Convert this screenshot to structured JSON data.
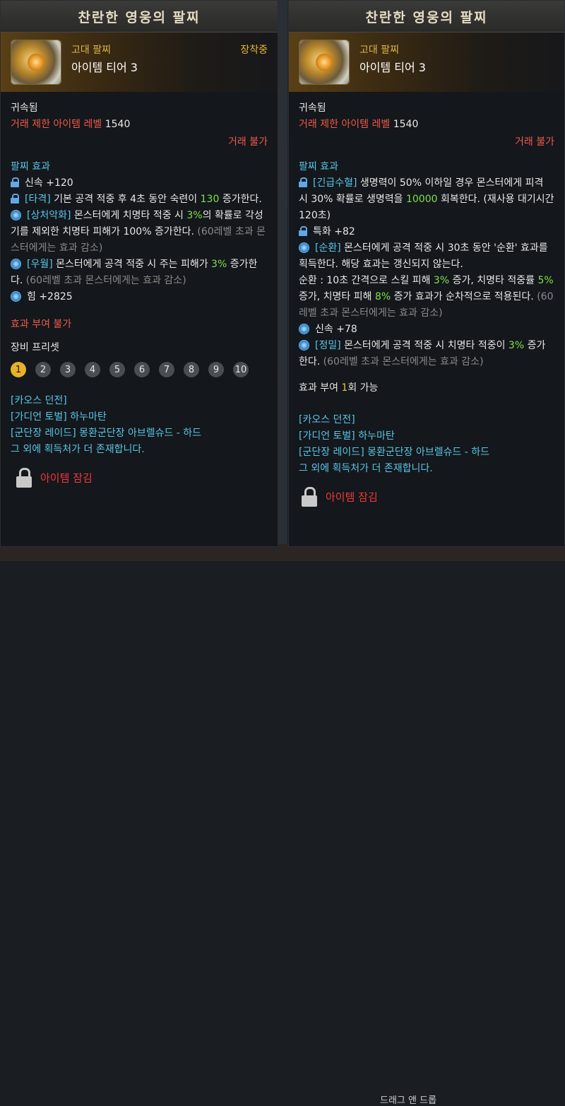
{
  "background": {
    "hint_text": "드래그 앤 드롭"
  },
  "left": {
    "title": "찬란한 영웅의 팔찌",
    "grade": "고대 팔찌",
    "tier": "아이템 티어 3",
    "equipped": "장착중",
    "bound": "귀속됨",
    "trade_level_label": "거래 제한 아이템 레벨",
    "trade_level_value": "1540",
    "trade": "거래 불가",
    "effects_title": "팔찌 효과",
    "effects": [
      {
        "icon": "lock-icon",
        "text": "신속 +120"
      },
      {
        "icon": "lock-icon",
        "pre": "[타격]",
        "text": " 기본 공격 적중 후 4초 동안 숙련이 ",
        "hl": "130",
        "post": " 증가한다."
      },
      {
        "icon": "gem-icon",
        "pre": "[상처악화]",
        "text": " 몬스터에게 치명타 적중 시 ",
        "hl": "3%",
        "post": "의 확률로 각성기를 제외한 치명타 피해가 100% 증가한다.",
        "note": " (60레벨 초과 몬스터에게는 효과 감소)"
      },
      {
        "icon": "gem-icon",
        "pre": "[우월]",
        "text": " 몬스터에게 공격 적중 시 주는 피해가 ",
        "hl": "3%",
        "post": " 증가한다.",
        "note": " (60레벨 초과 몬스터에게는 효과 감소)"
      },
      {
        "icon": "gem-icon",
        "text": "힘 +2825"
      }
    ],
    "grant": "효과 부여 불가",
    "preset_title": "장비 프리셋",
    "presets": [
      "1",
      "2",
      "3",
      "4",
      "5",
      "6",
      "7",
      "8",
      "9",
      "10"
    ],
    "sources": [
      "[카오스 던전]",
      "[가디언 토벌] 하누마탄",
      "[군단장 레이드] 몽환군단장 아브렐슈드 - 하드",
      "그 외에 획득처가 더 존재합니다."
    ],
    "lock_label": "아이템 잠김"
  },
  "right": {
    "title": "찬란한 영웅의 팔찌",
    "grade": "고대 팔찌",
    "tier": "아이템 티어 3",
    "bound": "귀속됨",
    "trade_level_label": "거래 제한 아이템 레벨",
    "trade_level_value": "1540",
    "trade": "거래 불가",
    "effects_title": "팔찌 효과",
    "effects": [
      {
        "icon": "lock-icon",
        "pre": "[긴급수혈]",
        "text": " 생명력이 50% 이하일 경우 몬스터에게 피격 시 30% 확률로 생명력을 ",
        "hl": "10000",
        "post": " 회복한다. (재사용 대기시간 120초)"
      },
      {
        "icon": "lock-icon",
        "text": "특화 +82"
      },
      {
        "icon": "gem-icon",
        "pre": "[순환]",
        "text": " 몬스터에게 공격 적중 시 30초 동안 '순환' 효과를 획득한다. 해당 효과는 갱신되지 않는다.",
        "extra1": "순환 : 10초 간격으로 스킬 피해 ",
        "hl": "3%",
        "extra2": " 증가, 치명타 적중률 ",
        "hl2": "5%",
        "extra3": " 증가, 치명타 피해 ",
        "hl3": "8%",
        "extra4": " 증가 효과가 순차적으로 적용된다.",
        "note": " (60레벨 초과 몬스터에게는 효과 감소)"
      },
      {
        "icon": "gem-icon",
        "text": "신속 +78"
      },
      {
        "icon": "gem-icon",
        "pre": "[정밀]",
        "text": " 몬스터에게 공격 적중 시 치명타 적중이 ",
        "hl": "3%",
        "post": " 증가한다.",
        "note": " (60레벨 초과 몬스터에게는 효과 감소)"
      }
    ],
    "grant_pre": "효과 부여 ",
    "grant_num": "1",
    "grant_post": "회 가능",
    "sources": [
      "[카오스 던전]",
      "[가디언 토벌] 하누마탄",
      "[군단장 레이드] 몽환군단장 아브렐슈드 - 하드",
      "그 외에 획득처가 더 존재합니다."
    ],
    "lock_label": "아이템 잠김"
  }
}
